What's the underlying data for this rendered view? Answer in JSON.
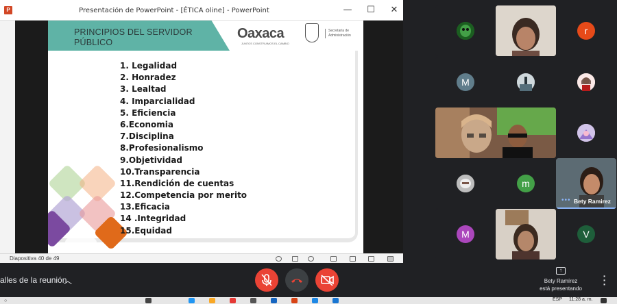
{
  "ppt": {
    "window_title": "Presentación de PowerPoint - [ÉTICA oline] - PowerPoint",
    "app_icon": "P",
    "status": "Diapositiva 40 de 49"
  },
  "slide": {
    "header_line1": "PRINCIPIOS DEL SERVIDOR",
    "header_line2": "PÚBLICO",
    "logo_text": "Oaxaca",
    "logo_tagline": "JUNTOS CONSTRUIMOS EL CAMBIO",
    "secretaria_line1": "Secretaría de",
    "secretaria_line2": "Administración",
    "principles": [
      "1. Legalidad",
      "2. Honradez",
      "3. Lealtad",
      "4. Imparcialidad",
      "5. Eficiencia",
      "6.Economia",
      "7.Disciplina",
      "8.Profesionalismo",
      "9.Objetividad",
      "10.Transparencia",
      "11.Rendición de cuentas",
      "12.Competencia por merito",
      "13.Eficacia",
      "14 .Integridad",
      "15.Equidad"
    ]
  },
  "participants": {
    "initials": {
      "r": "r",
      "M1": "M",
      "m": "m",
      "M2": "M",
      "V": "V"
    },
    "bety_name": "Bety Ramirez",
    "colors": {
      "r": "#e64a19",
      "M1": "#607d8b",
      "m": "#43a047",
      "M2": "#ab47bc",
      "V": "#1e5e3a"
    }
  },
  "toolbar": {
    "meeting_details": "alles de la reunión",
    "mic_icon": "mic-off-icon",
    "hangup_icon": "hangup-icon",
    "cam_icon": "camera-off-icon",
    "presenting_line1": "Bety Ramírez",
    "presenting_line2": "está presentando"
  },
  "taskbar": {
    "language": "ESP",
    "time": "11:28 a. m."
  }
}
